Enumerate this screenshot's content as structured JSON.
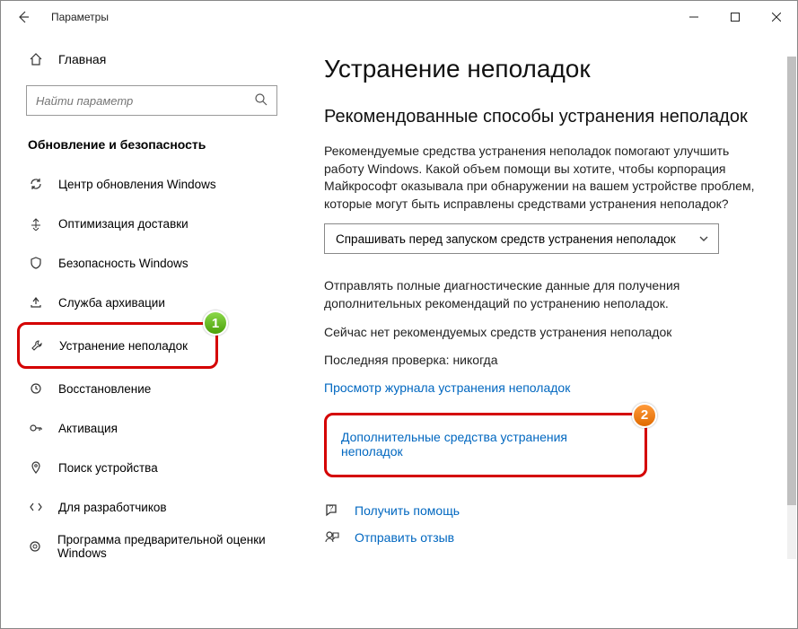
{
  "titlebar": {
    "title": "Параметры"
  },
  "sidebar": {
    "home": "Главная",
    "search_placeholder": "Найти параметр",
    "section": "Обновление и безопасность",
    "items": [
      {
        "label": "Центр обновления Windows"
      },
      {
        "label": "Оптимизация доставки"
      },
      {
        "label": "Безопасность Windows"
      },
      {
        "label": "Служба архивации"
      },
      {
        "label": "Устранение неполадок"
      },
      {
        "label": "Восстановление"
      },
      {
        "label": "Активация"
      },
      {
        "label": "Поиск устройства"
      },
      {
        "label": "Для разработчиков"
      },
      {
        "label": "Программа предварительной оценки Windows"
      }
    ]
  },
  "main": {
    "heading": "Устранение неполадок",
    "subheading": "Рекомендованные способы устранения неполадок",
    "desc": "Рекомендуемые средства устранения неполадок помогают улучшить работу Windows. Какой объем помощи вы хотите, чтобы корпорация Майкрософт оказывала при обнаружении на вашем устройстве проблем, которые могут быть исправлены средствами устранения неполадок?",
    "dropdown": "Спрашивать перед запуском средств устранения неполадок",
    "warn": "Отправлять полные диагностические данные для получения дополнительных рекомендаций по устранению неполадок.",
    "no_rec": "Сейчас нет рекомендуемых средств устранения неполадок",
    "last_check": "Последняя проверка: никогда",
    "history_link": "Просмотр журнала устранения неполадок",
    "more_link": "Дополнительные средства устранения неполадок",
    "help": "Получить помощь",
    "feedback": "Отправить отзыв"
  },
  "badges": {
    "one": "1",
    "two": "2"
  }
}
